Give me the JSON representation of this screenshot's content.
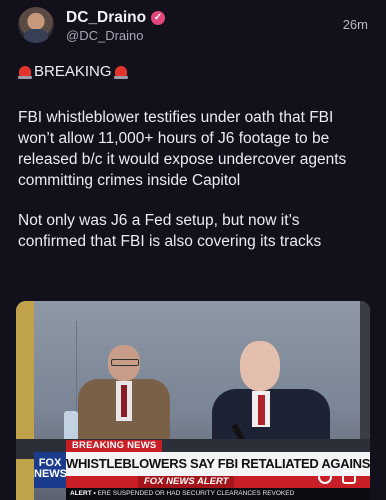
{
  "author": {
    "display_name": "DC_Draino",
    "handle": "@DC_Draino",
    "verified_icon": "verified-badge-icon",
    "avatar_icon": "avatar"
  },
  "timestamp": "26m",
  "post": {
    "breaking_label": "BREAKING",
    "paragraph_1": "FBI whistleblower testifies under oath that FBI won’t allow 11,000+ hours of J6 footage to be released b/c it would expose undercover agents committing crimes inside Capitol",
    "paragraph_2": "Not only was J6 a Fed setup, but now it’s confirmed that FBI is also covering its tracks"
  },
  "media": {
    "breaking_tag": "BREAKING NEWS",
    "headline": "WHISTLEBLOWERS SAY FBI RETALIATED AGAINST THEM",
    "network_logo": "FOX NEWS",
    "alert_brand": "FOX NEWS ALERT",
    "ticker_lead": "ALERT •",
    "ticker_text": "ERE SUSPENDED OR HAD SECURITY CLEARANCES REVOKED"
  },
  "colors": {
    "background": "#12101a",
    "verified": "#e0457b",
    "chyron_red": "#c81e26",
    "fox_blue": "#1b3c8c"
  }
}
